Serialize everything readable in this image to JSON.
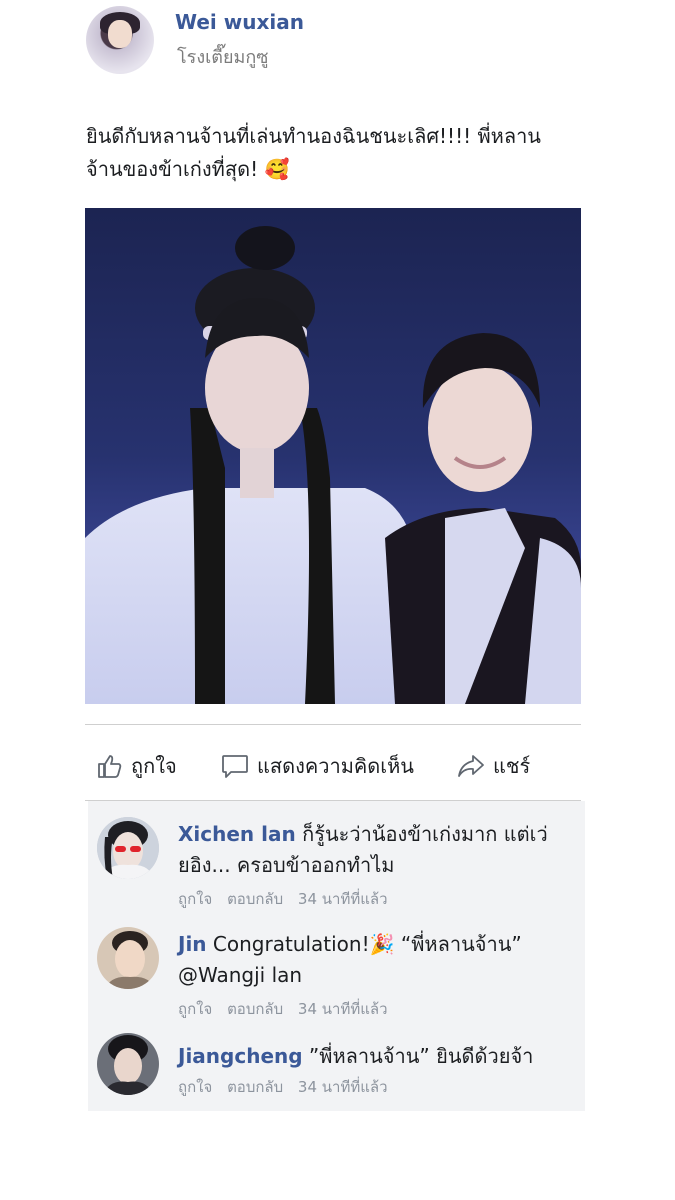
{
  "post": {
    "author": "Wei wuxian",
    "subtitle": "โรงเตี๊ยมกูซู",
    "text_line1": "ยินดีกับหลานจ้านที่เล่นทำนองฉินชนะเลิศ!!!! พี่หลาน",
    "text_line2": "จ้านของข้าเก่งที่สุด! 🥰"
  },
  "actions": {
    "like": "ถูกใจ",
    "comment": "แสดงความคิดเห็น",
    "share": "แชร์"
  },
  "comments": [
    {
      "name": "Xichen lan",
      "text_line1": "ก็รู้นะว่าน้องข้าเก่งมาก แต่เว่",
      "text_line2": "ยอิง... ครอบข้าออกทำไม",
      "like": "ถูกใจ",
      "reply": "ตอบกลับ",
      "time": "34 นาทีที่แล้ว"
    },
    {
      "name": "Jin",
      "text_line1": "Congratulation!🎉 “พี่หลานจ้าน”",
      "text_line2": "@Wangji lan",
      "like": "ถูกใจ",
      "reply": "ตอบกลับ",
      "time": "34 นาทีที่แล้ว"
    },
    {
      "name": "Jiangcheng",
      "text_line1": "”พี่หลานจ้าน” ยินดีด้วยจ้า",
      "like": "ถูกใจ",
      "reply": "ตอบกลับ",
      "time": "34 นาทีที่แล้ว"
    }
  ],
  "colors": {
    "name_blue": "#3b5998",
    "meta_gray": "#8d949e",
    "comment_bg": "#f2f3f5"
  }
}
